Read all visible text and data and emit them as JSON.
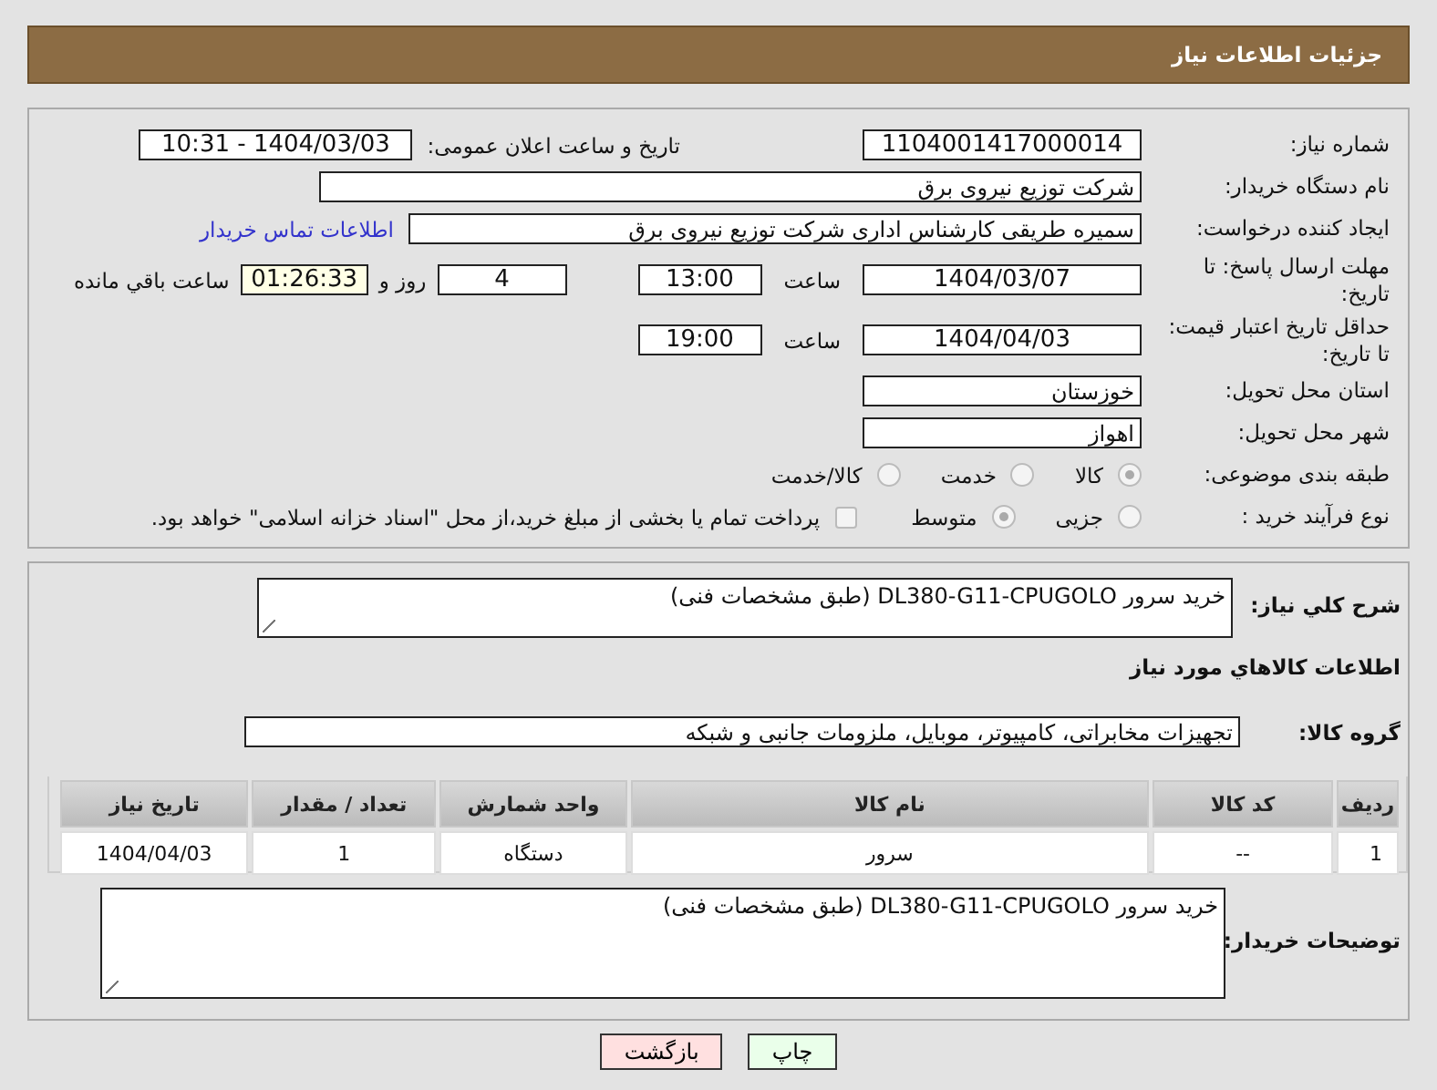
{
  "header": {
    "title": "جزئیات اطلاعات نیاز"
  },
  "need_number": {
    "label": "شماره نیاز:",
    "value": "1104001417000014"
  },
  "announce": {
    "label": "تاریخ و ساعت اعلان عمومی:",
    "value": "1404/03/03 - 10:31"
  },
  "buyer_org": {
    "label": "نام دستگاه خریدار:",
    "value": "شرکت توزیع نیروی برق"
  },
  "requester": {
    "label": "ایجاد کننده درخواست:",
    "value": "سمیره طریقی کارشناس اداری  شرکت توزیع نیروی برق",
    "link": "اطلاعات تماس خریدار"
  },
  "deadline": {
    "label": "مهلت ارسال پاسخ: تا تاریخ:",
    "date": "1404/03/07",
    "time_label": "ساعت",
    "time": "13:00",
    "days": "4",
    "days_label": "روز و",
    "remaining": "01:26:33",
    "remaining_label": "ساعت باقي مانده"
  },
  "validity": {
    "label": "حداقل تاریخ اعتبار قیمت: تا تاریخ:",
    "date": "1404/04/03",
    "time_label": "ساعت",
    "time": "19:00"
  },
  "province": {
    "label": "استان محل تحویل:",
    "value": "خوزستان"
  },
  "city": {
    "label": "شهر محل تحویل:",
    "value": "اهواز"
  },
  "category": {
    "label": "طبقه بندی موضوعی:",
    "options": [
      {
        "label": "کالا",
        "selected": true
      },
      {
        "label": "خدمت",
        "selected": false
      },
      {
        "label": "کالا/خدمت",
        "selected": false
      }
    ]
  },
  "process": {
    "label": "نوع فرآیند خرید :",
    "options": [
      {
        "label": "جزیی",
        "selected": false
      },
      {
        "label": "متوسط",
        "selected": true
      }
    ],
    "treasury": {
      "label": "پرداخت تمام یا بخشی از مبلغ خرید،از محل \"اسناد خزانه اسلامی\" خواهد بود.",
      "checked": false
    }
  },
  "description": {
    "label": "شرح کلي نياز:",
    "value": "خرید سرور DL380-G11-CPUGOLO (طبق مشخصات فنی)"
  },
  "goods_heading": "اطلاعات کالاهاي مورد نياز",
  "goods_group": {
    "label": "گروه کالا:",
    "value": "تجهیزات مخابراتی، کامپیوتر، موبایل، ملزومات جانبی و شبکه"
  },
  "table": {
    "columns": [
      "ردیف",
      "کد کالا",
      "نام کالا",
      "واحد شمارش",
      "تعداد / مقدار",
      "تاریخ نیاز"
    ],
    "rows": [
      [
        "1",
        "--",
        "سرور",
        "دستگاه",
        "1",
        "1404/04/03"
      ]
    ]
  },
  "buyer_notes": {
    "label": "توضیحات خریدار:",
    "value": "خرید سرور DL380-G11-CPUGOLO (طبق مشخصات فنی)"
  },
  "buttons": [
    {
      "label": "چاپ",
      "kind": "print"
    },
    {
      "label": "بازگشت",
      "kind": "back"
    }
  ]
}
